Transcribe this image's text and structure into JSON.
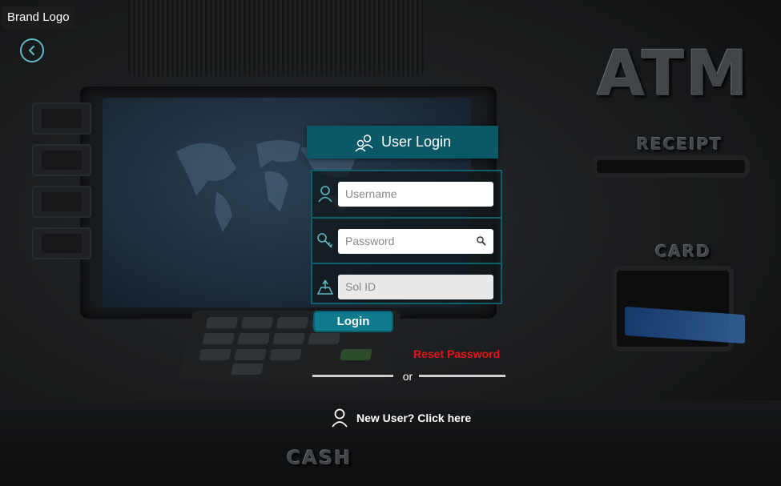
{
  "brand": {
    "logo_text": "Brand Logo"
  },
  "nav": {
    "back_icon": "chevron-left-icon"
  },
  "login": {
    "title": "User Login",
    "title_icon": "users-icon",
    "username_placeholder": "Username",
    "password_placeholder": "Password",
    "solid_placeholder": "Sol ID",
    "submit_label": "Login",
    "reset_label": "Reset Password",
    "or_label": "or",
    "new_user_label": "New User? Click here"
  },
  "background": {
    "emboss_atm": "ATM",
    "emboss_receipt": "RECEIPT",
    "emboss_card": "CARD",
    "emboss_cash": "CASH"
  },
  "colors": {
    "accent": "#0b5866",
    "button": "#0e7a8c",
    "icon": "#5fb9c4",
    "reset": "#e8141c"
  }
}
